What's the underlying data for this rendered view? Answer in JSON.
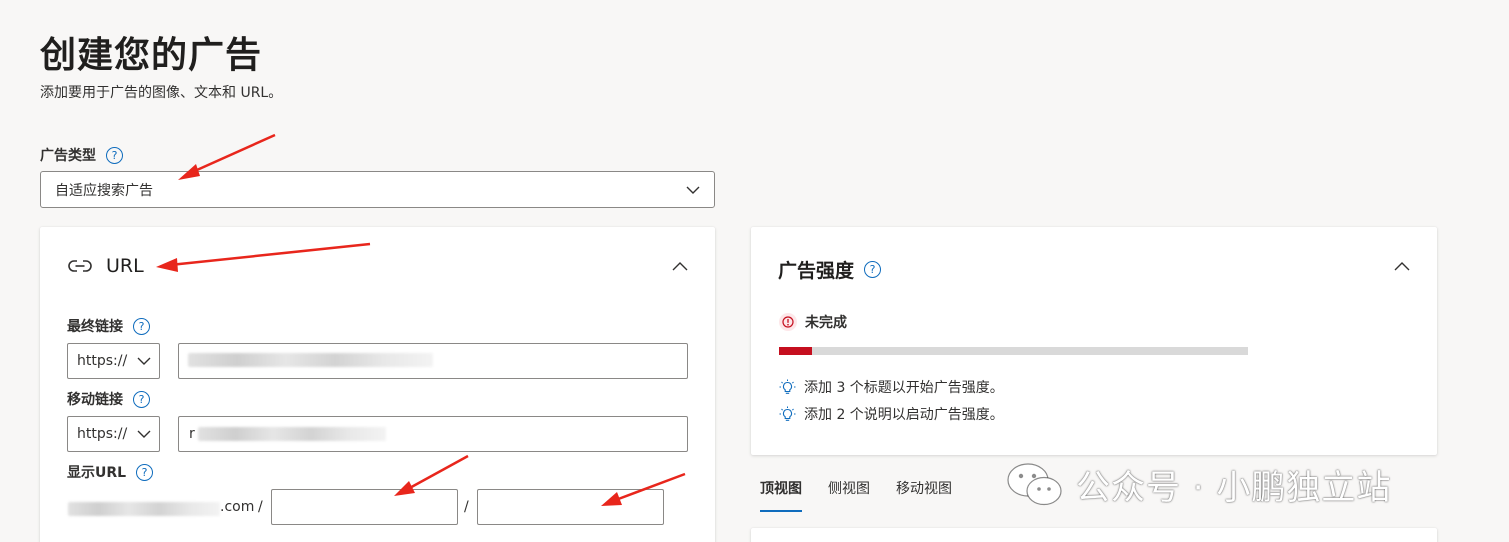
{
  "page": {
    "title": "创建您的广告",
    "subtitle": "添加要用于广告的图像、文本和 URL。"
  },
  "ad_type": {
    "label": "广告类型",
    "value": "自适应搜索广告"
  },
  "url_section": {
    "title": "URL",
    "final_url": {
      "label": "最终链接",
      "protocol": "https://",
      "value": ""
    },
    "mobile_url": {
      "label": "移动链接",
      "protocol": "https://",
      "value": "r"
    },
    "display_url": {
      "label": "显示URL",
      "domain_suffix": ".com",
      "separator": "/",
      "path1": "",
      "path2": ""
    }
  },
  "ad_strength": {
    "title": "广告强度",
    "status": "未完成",
    "progress_fraction": 0.07,
    "tips": [
      "添加 3 个标题以开始广告强度。",
      "添加 2 个说明以启动广告强度。"
    ]
  },
  "preview_tabs": [
    {
      "label": "顶视图",
      "active": true
    },
    {
      "label": "侧视图",
      "active": false
    },
    {
      "label": "移动视图",
      "active": false
    }
  ],
  "watermark": {
    "text": "公众号 · 小鹏独立站",
    "logo": "wechat-logo"
  },
  "colors": {
    "accent": "#0f6cbd",
    "error": "#c50f1f",
    "annotation_arrow": "#e8261c"
  },
  "icons": {
    "help": "question-circle-icon",
    "link": "link-icon",
    "chevron_down": "chevron-down-icon",
    "chevron_up": "chevron-up-icon",
    "warning": "error-circle-icon",
    "tip": "lightbulb-icon"
  }
}
